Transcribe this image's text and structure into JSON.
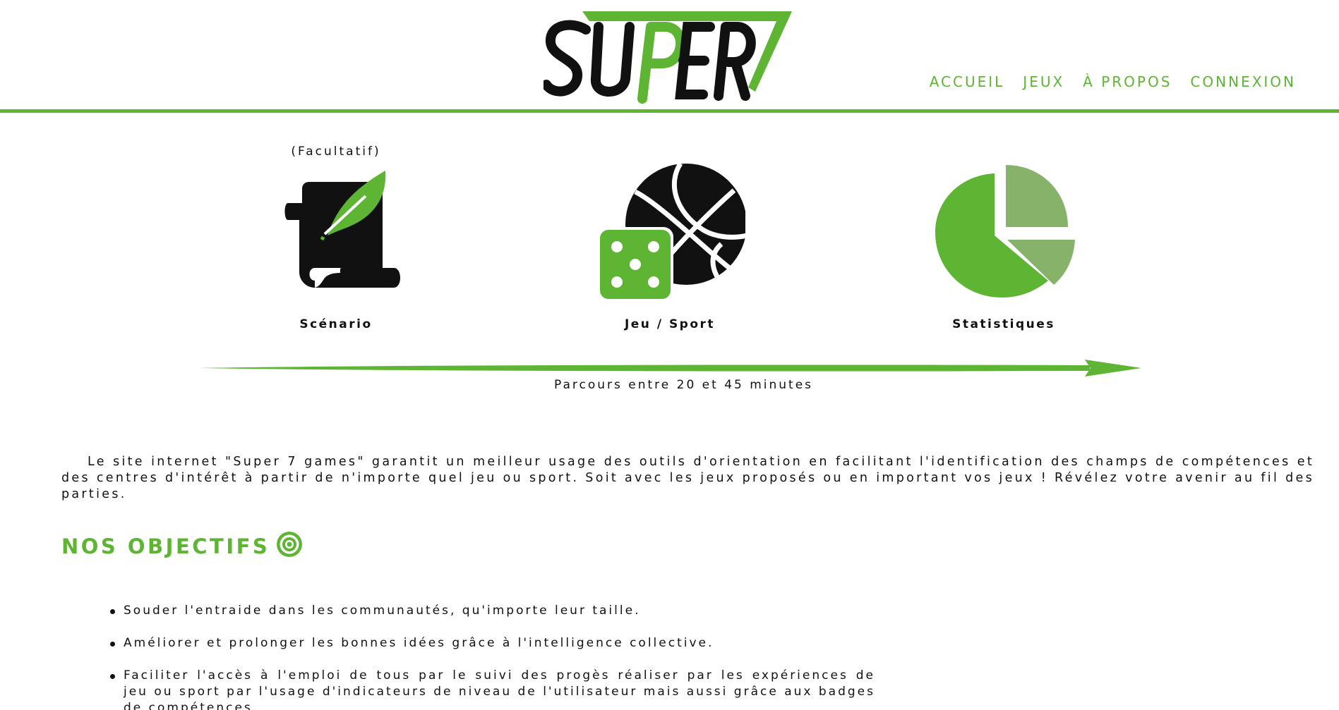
{
  "brand": {
    "logo_text": "SUPER 7",
    "colors": {
      "accent": "#5db533",
      "accent_light": "#86b26a",
      "ink": "#111111"
    }
  },
  "nav": {
    "items": [
      {
        "label": "ACCUEIL"
      },
      {
        "label": "JEUX"
      },
      {
        "label": "À PROPOS"
      },
      {
        "label": "CONNEXION"
      }
    ]
  },
  "journey": {
    "steps": [
      {
        "label": "Scénario",
        "note": "(Facultatif)",
        "icon": "scroll-quill-icon"
      },
      {
        "label": "Jeu / Sport",
        "icon": "basketball-dice-icon"
      },
      {
        "label": "Statistiques",
        "icon": "pie-chart-icon"
      }
    ],
    "duration": "Parcours entre 20 et 45 minutes"
  },
  "intro": {
    "text": "Le site internet \"Super 7 games\" garantit un meilleur usage des outils d'orientation en facilitant l'identification des champs de compétences et des centres d'intérêt à partir de n'importe quel jeu ou sport. Soit avec les jeux proposés ou en important vos jeux ! Révélez votre avenir au fil des parties."
  },
  "objectives": {
    "title": "NOS OBJECTIFS",
    "icon": "target-icon",
    "items": [
      "Souder l'entraide dans les communautés, qu'importe leur taille.",
      "Améliorer et prolonger les bonnes idées grâce à l'intelligence collective.",
      "Faciliter l'accès à l'emploi de tous par le suivi des progès réaliser par les expériences de jeu ou sport par l'usage d'indicateurs de niveau de l'utilisateur mais aussi grâce aux badges de compétences."
    ]
  }
}
